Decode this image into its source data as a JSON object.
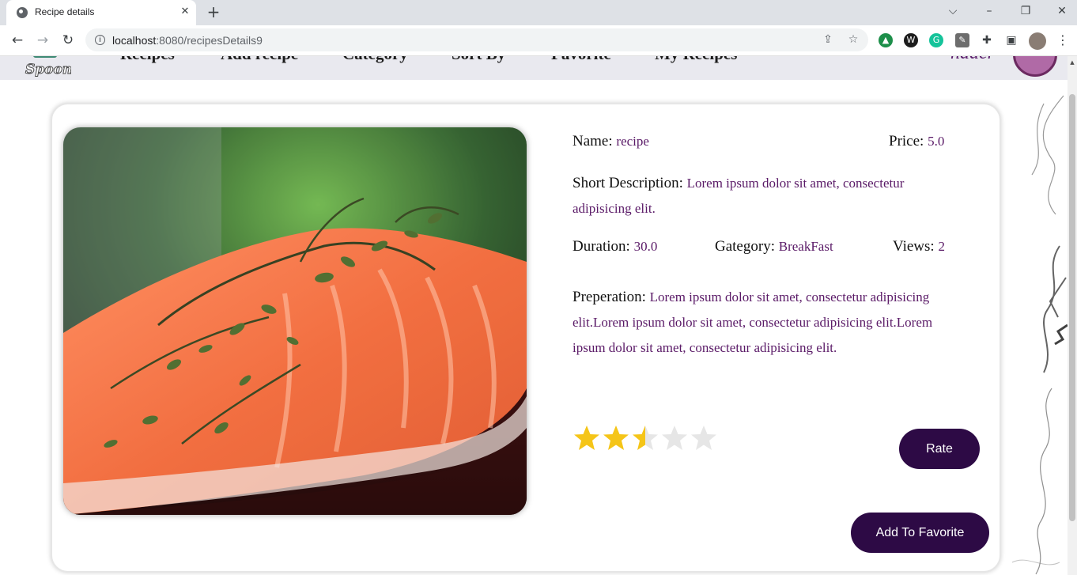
{
  "browser": {
    "tab_title": "Recipe details",
    "url_host": "localhost",
    "url_rest": ":8080/recipesDetails9",
    "new_tab_glyph": "+",
    "close_glyph": "✕"
  },
  "site_nav": {
    "links": [
      "Recipes",
      "Add recipe",
      "Category",
      "Sort By",
      "Favorite",
      "My Recipes"
    ],
    "user_name": "nader"
  },
  "recipe": {
    "name_label": "Name:",
    "name": "recipe",
    "price_label": "Price:",
    "price": "5.0",
    "short_desc_label": "Short Description:",
    "short_desc": "Lorem ipsum dolor sit amet, consectetur adipisicing elit.",
    "duration_label": "Duration:",
    "duration": "30.0",
    "category_label": "Gategory:",
    "category": "BreakFast",
    "views_label": "Views:",
    "views": "2",
    "preparation_label": "Preperation:",
    "preparation": "Lorem ipsum dolor sit amet, consectetur adipisicing elit.Lorem ipsum dolor sit amet, consectetur adipisicing elit.Lorem ipsum dolor sit amet, consectetur adipisicing elit.",
    "rating": 2.5,
    "rating_max": 5
  },
  "buttons": {
    "rate": "Rate",
    "add_favorite": "Add To Favorite"
  },
  "colors": {
    "accent": "#2d0a45",
    "value_text": "#5a1a67",
    "star_filled": "#f5c518",
    "star_empty": "#e6e6e6"
  },
  "icons": [
    "globe-icon",
    "back-arrow-icon",
    "forward-arrow-icon",
    "reload-icon",
    "info-icon",
    "share-icon",
    "bookmark-star-icon",
    "extensions-icon",
    "side-panel-icon",
    "more-menu-icon",
    "star-icon"
  ]
}
